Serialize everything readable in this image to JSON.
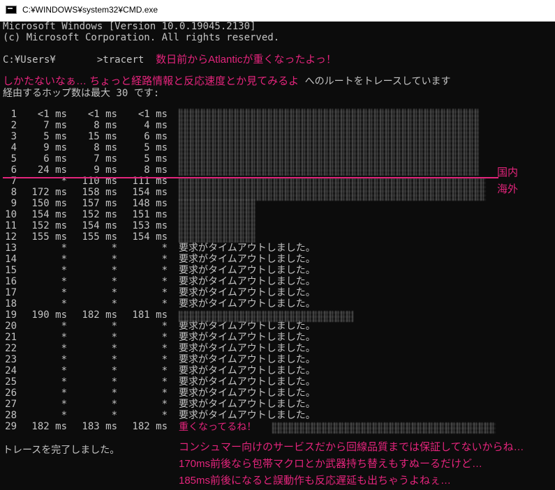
{
  "window": {
    "title": "C:¥WINDOWS¥system32¥CMD.exe",
    "icon": "cmd-icon"
  },
  "header_lines": [
    "Microsoft Windows [Version 10.0.19045.2130]",
    "(c) Microsoft Corporation. All rights reserved."
  ],
  "prompt": {
    "path": "C:¥Users¥",
    "command": ">tracert",
    "comment": "数日前からAtlanticが重くなったよっ！"
  },
  "trace_intro": {
    "comment": "しかたないなぁ… ちょっと経路情報と反応速度とか見てみるよ",
    "suffix": "へのルートをトレースしています",
    "hops_line": "経由するホップ数は最大 30 です:"
  },
  "hops": [
    {
      "hop": "1",
      "t1": "<1 ms",
      "t2": "<1 ms",
      "t3": "<1 ms",
      "host": ""
    },
    {
      "hop": "2",
      "t1": "7 ms",
      "t2": "8 ms",
      "t3": "4 ms",
      "host": ""
    },
    {
      "hop": "3",
      "t1": "5 ms",
      "t2": "15 ms",
      "t3": "6 ms",
      "host": ""
    },
    {
      "hop": "4",
      "t1": "9 ms",
      "t2": "8 ms",
      "t3": "5 ms",
      "host": ""
    },
    {
      "hop": "5",
      "t1": "6 ms",
      "t2": "7 ms",
      "t3": "5 ms",
      "host": ""
    },
    {
      "hop": "6",
      "t1": "24 ms",
      "t2": "9 ms",
      "t3": "8 ms",
      "host": ""
    },
    {
      "hop": "7",
      "t1": "*",
      "t2": "110 ms",
      "t3": "111 ms",
      "host": ""
    },
    {
      "hop": "8",
      "t1": "172 ms",
      "t2": "158 ms",
      "t3": "154 ms",
      "host": ""
    },
    {
      "hop": "9",
      "t1": "150 ms",
      "t2": "157 ms",
      "t3": "148 ms",
      "host": ""
    },
    {
      "hop": "10",
      "t1": "154 ms",
      "t2": "152 ms",
      "t3": "151 ms",
      "host": ""
    },
    {
      "hop": "11",
      "t1": "152 ms",
      "t2": "154 ms",
      "t3": "153 ms",
      "host": ""
    },
    {
      "hop": "12",
      "t1": "155 ms",
      "t2": "155 ms",
      "t3": "154 ms",
      "host": ""
    },
    {
      "hop": "13",
      "t1": "*",
      "t2": "*",
      "t3": "*",
      "host": "要求がタイムアウトしました。"
    },
    {
      "hop": "14",
      "t1": "*",
      "t2": "*",
      "t3": "*",
      "host": "要求がタイムアウトしました。"
    },
    {
      "hop": "15",
      "t1": "*",
      "t2": "*",
      "t3": "*",
      "host": "要求がタイムアウトしました。"
    },
    {
      "hop": "16",
      "t1": "*",
      "t2": "*",
      "t3": "*",
      "host": "要求がタイムアウトしました。"
    },
    {
      "hop": "17",
      "t1": "*",
      "t2": "*",
      "t3": "*",
      "host": "要求がタイムアウトしました。"
    },
    {
      "hop": "18",
      "t1": "*",
      "t2": "*",
      "t3": "*",
      "host": "要求がタイムアウトしました。"
    },
    {
      "hop": "19",
      "t1": "190 ms",
      "t2": "182 ms",
      "t3": "181 ms",
      "host": ""
    },
    {
      "hop": "20",
      "t1": "*",
      "t2": "*",
      "t3": "*",
      "host": "要求がタイムアウトしました。"
    },
    {
      "hop": "21",
      "t1": "*",
      "t2": "*",
      "t3": "*",
      "host": "要求がタイムアウトしました。"
    },
    {
      "hop": "22",
      "t1": "*",
      "t2": "*",
      "t3": "*",
      "host": "要求がタイムアウトしました。"
    },
    {
      "hop": "23",
      "t1": "*",
      "t2": "*",
      "t3": "*",
      "host": "要求がタイムアウトしました。"
    },
    {
      "hop": "24",
      "t1": "*",
      "t2": "*",
      "t3": "*",
      "host": "要求がタイムアウトしました。"
    },
    {
      "hop": "25",
      "t1": "*",
      "t2": "*",
      "t3": "*",
      "host": "要求がタイムアウトしました。"
    },
    {
      "hop": "26",
      "t1": "*",
      "t2": "*",
      "t3": "*",
      "host": "要求がタイムアウトしました。"
    },
    {
      "hop": "27",
      "t1": "*",
      "t2": "*",
      "t3": "*",
      "host": "要求がタイムアウトしました。"
    },
    {
      "hop": "28",
      "t1": "*",
      "t2": "*",
      "t3": "*",
      "host": "要求がタイムアウトしました。"
    },
    {
      "hop": "29",
      "t1": "182 ms",
      "t2": "183 ms",
      "t3": "182 ms",
      "host": "重くなってるね！"
    }
  ],
  "done_line": "トレースを完了しました。",
  "annotations": {
    "domestic": "国内",
    "overseas": "海外",
    "comment1": "コンシュマー向けのサービスだから回線品質までは保証してないからね…",
    "comment2": "170ms前後なら包帯マクロとか武器持ち替えもすぬーるだけど…",
    "comment3": "185ms前後になると誤動作も反応遅延も出ちゃうよねぇ…"
  },
  "colors": {
    "background": "#0c0c0c",
    "text": "#c4c4c4",
    "accent": "#e4247c"
  }
}
